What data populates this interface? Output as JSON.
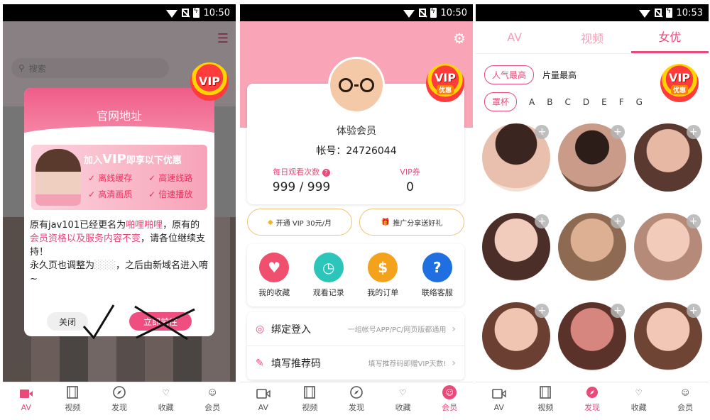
{
  "status": {
    "time_1": "10:50",
    "time_2": "10:50",
    "time_3": "10:53"
  },
  "vip_badge": {
    "vip": "VIP",
    "discount": "优惠"
  },
  "nav": {
    "av": "AV",
    "video": "视频",
    "discover": "发现",
    "favorites": "收藏",
    "member": "会员"
  },
  "phone1": {
    "search_placeholder": "搜索",
    "dialog": {
      "title": "官网地址",
      "banner_title_prefix": "加入",
      "banner_title_vip": "VIP",
      "banner_title_suffix": "即享以下优惠",
      "features": [
        "离线缓存",
        "高速线路",
        "高清画质",
        "倍速播放"
      ],
      "msg_1": "原有jav101已经更名为",
      "msg_name": "啪哩啪哩",
      "msg_2": "，原有的",
      "msg_pink2": "会员资格以及服务内容不变",
      "msg_3": "，请各位继续支持！",
      "msg_4": "永久页也调整为",
      "msg_5": "，之后由新域名进入唷~",
      "close_label": "关闭",
      "go_label": "立即前往"
    }
  },
  "phone2": {
    "member_type": "体验会员",
    "account": "帐号：24726044",
    "stats": [
      {
        "label": "每日观看次数",
        "value": "999 / 999"
      },
      {
        "label": "VIP券",
        "value": "0"
      }
    ],
    "pill_vip": "开通 VIP 30元/月",
    "pill_share": "推广分享送好礼",
    "icons": [
      {
        "label": "我的收藏",
        "color": "#f0506e"
      },
      {
        "label": "观看记录",
        "color": "#2bc6b9"
      },
      {
        "label": "我的订单",
        "color": "#f4a21c"
      },
      {
        "label": "联络客服",
        "color": "#1f6fe0"
      }
    ],
    "list": [
      {
        "title": "绑定登入",
        "hint": "一组帐号APP/PC/网页版都通用"
      },
      {
        "title": "填写推荐码",
        "hint": "填写推荐码即赠VIP天数!"
      }
    ]
  },
  "phone3": {
    "tabs": [
      "AV",
      "视频",
      "女优"
    ],
    "sort_popular": "人气最高",
    "sort_count": "片量最高",
    "cup": "罩杯",
    "letters": [
      "A",
      "B",
      "C",
      "D",
      "E",
      "F",
      "G"
    ],
    "actress_count": 9
  }
}
